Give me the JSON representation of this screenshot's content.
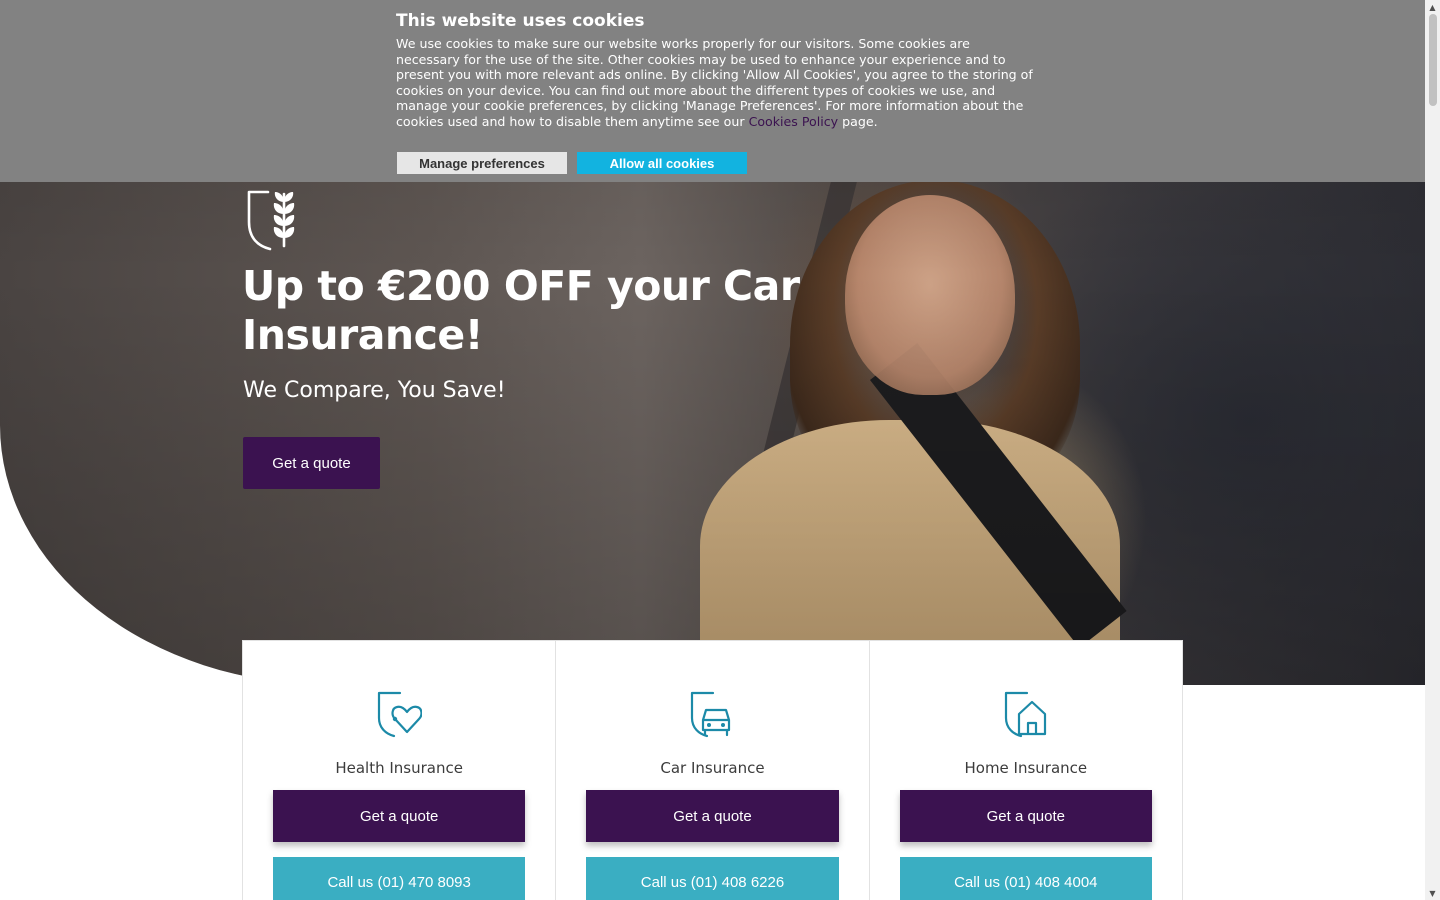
{
  "cookie_banner": {
    "title": "This website uses cookies",
    "text_before_link": "We use cookies to make sure our website works properly for our visitors. Some cookies are necessary for the use of the site. Other cookies may be used to enhance your experience and to present you with more relevant ads online. By clicking 'Allow All Cookies', you agree to the storing of cookies on your device. You can find out more about the different types of cookies we use, and manage your cookie preferences, by clicking 'Manage Preferences'. For more information about the cookies used and how to disable them anytime see our ",
    "link_text": "Cookies Policy",
    "text_after_link": " page.",
    "manage_label": "Manage preferences",
    "allow_label": "Allow all cookies"
  },
  "hero": {
    "title": "Up to €200 OFF your Car Insurance!",
    "subtitle": "We Compare, You Save!",
    "cta_label": "Get a quote"
  },
  "cards": [
    {
      "icon": "health-heart-icon",
      "title": "Health Insurance",
      "quote_label": "Get a quote",
      "call_label": "Call us (01) 470 8093"
    },
    {
      "icon": "car-icon",
      "title": "Car Insurance",
      "quote_label": "Get a quote",
      "call_label": "Call us (01) 408 6226"
    },
    {
      "icon": "house-icon",
      "title": "Home Insurance",
      "quote_label": "Get a quote",
      "call_label": "Call us (01) 408 4004"
    }
  ],
  "colors": {
    "brand_purple": "#3b1250",
    "cookie_allow": "#12b3e0",
    "call_teal": "#3aaec2",
    "icon_teal": "#1c8aa8",
    "banner_gray": "#828282"
  }
}
